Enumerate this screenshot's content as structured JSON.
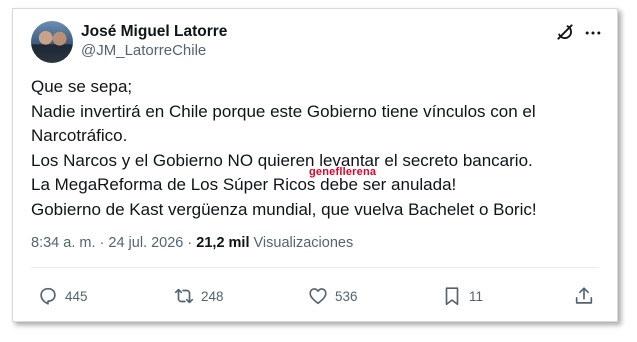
{
  "author": {
    "name": "José Miguel Latorre",
    "handle": "@JM_LatorreChile"
  },
  "tweet": {
    "lines": [
      "Que se sepa;",
      "Nadie invertirá en Chile porque este Gobierno tiene vínculos con el",
      "Narcotráfico.",
      "Los Narcos y el Gobierno NO quieren levantar el secreto bancario.",
      "La MegaReforma de Los Súper Ricos debe ser anulada!",
      "Gobierno de Kast vergüenza mundial, que vuelva Bachelet o Boric!"
    ],
    "watermark": "genefllerena"
  },
  "meta": {
    "time": "8:34 a. m.",
    "separator1": "·",
    "date": "24 jul. 2026",
    "separator2": "·",
    "views_count": "21,2 mil",
    "views_label": "Visualizaciones"
  },
  "actions": {
    "replies": "445",
    "retweets": "248",
    "likes": "536",
    "bookmarks": "11"
  },
  "icons": {
    "grok": "grok-icon",
    "more": "more-icon",
    "reply": "reply-icon",
    "retweet": "retweet-icon",
    "like": "heart-icon",
    "bookmark": "bookmark-icon",
    "share": "share-icon"
  },
  "colors": {
    "text": "#0f1419",
    "secondary": "#536471",
    "watermark": "#e0002b"
  }
}
